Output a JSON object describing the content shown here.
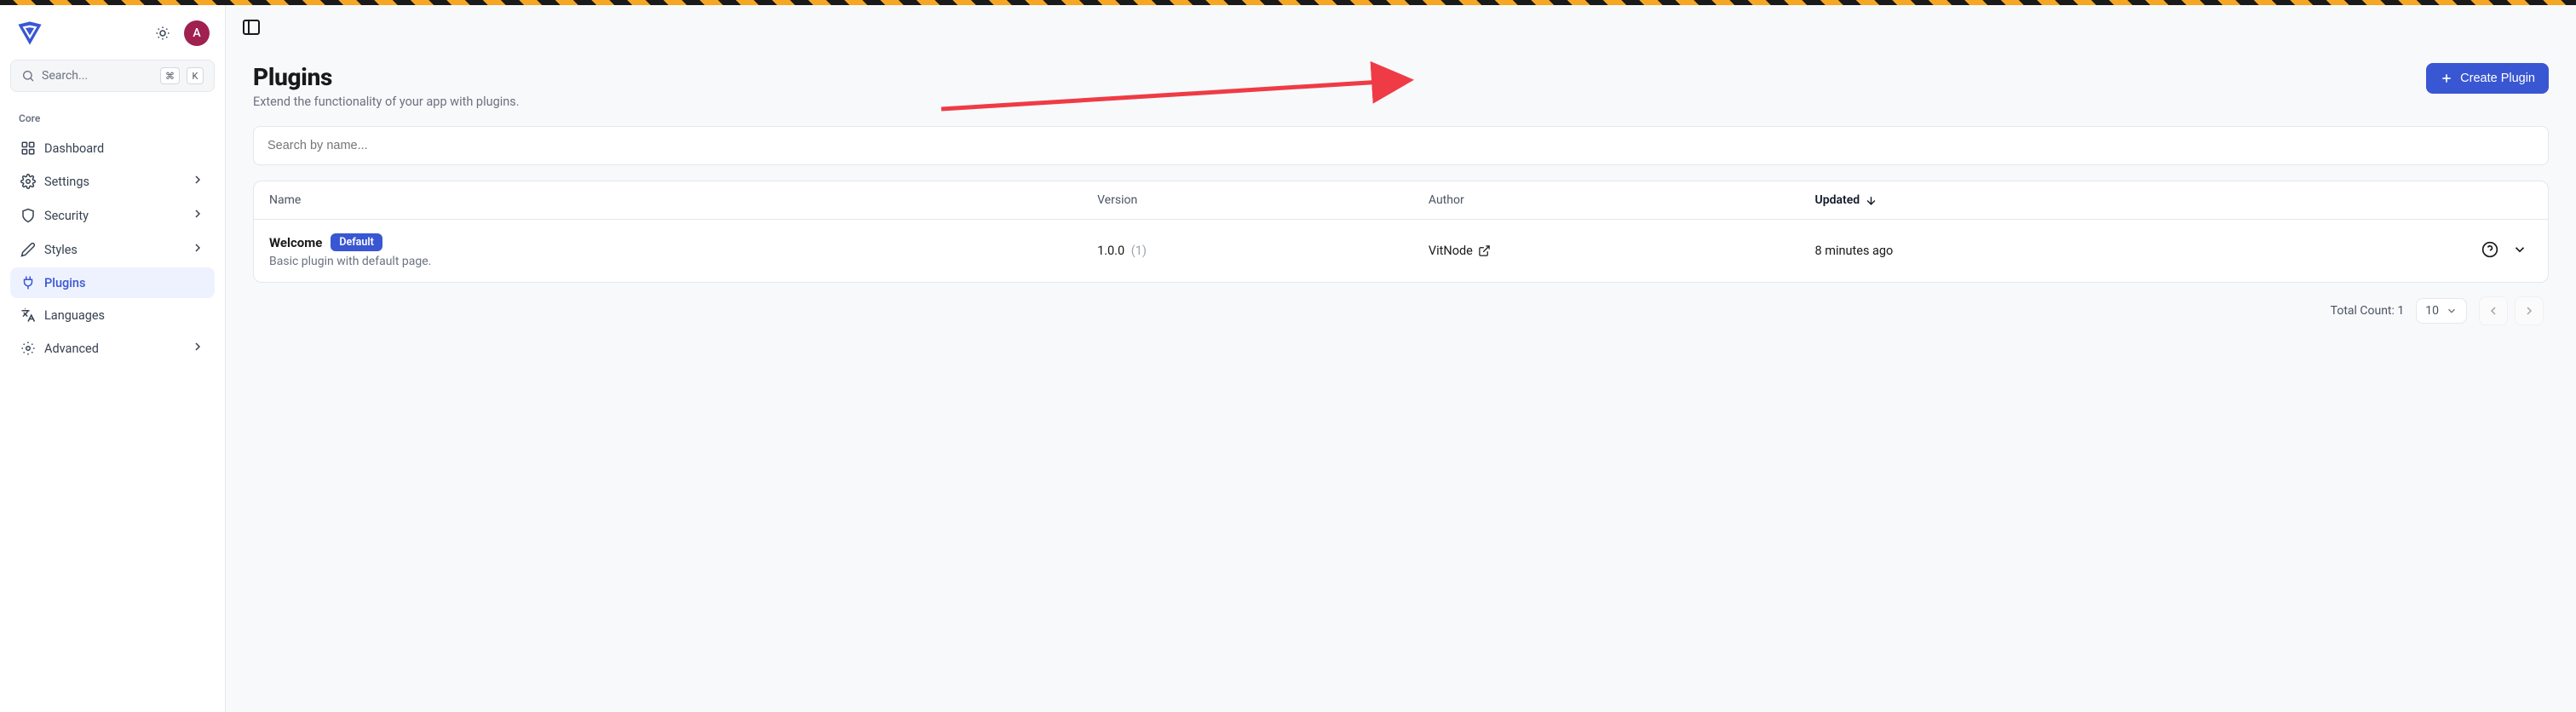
{
  "avatar_letter": "A",
  "search_launcher": {
    "placeholder": "Search...",
    "kbd1": "⌘",
    "kbd2": "K"
  },
  "sidebar": {
    "section_label": "Core",
    "items": [
      {
        "label": "Dashboard",
        "icon": "grid"
      },
      {
        "label": "Settings",
        "icon": "gear",
        "expandable": true
      },
      {
        "label": "Security",
        "icon": "shield",
        "expandable": true
      },
      {
        "label": "Styles",
        "icon": "pencil",
        "expandable": true
      },
      {
        "label": "Plugins",
        "icon": "plug",
        "active": true
      },
      {
        "label": "Languages",
        "icon": "lang"
      },
      {
        "label": "Advanced",
        "icon": "gear2",
        "expandable": true
      }
    ]
  },
  "page": {
    "title": "Plugins",
    "subtitle": "Extend the functionality of your app with plugins.",
    "create_label": "Create Plugin",
    "search_placeholder": "Search by name..."
  },
  "table": {
    "columns": {
      "name": "Name",
      "version": "Version",
      "author": "Author",
      "updated": "Updated"
    },
    "row": {
      "name": "Welcome",
      "badge": "Default",
      "desc": "Basic plugin with default page.",
      "version": "1.0.0",
      "version_sub": "(1)",
      "author": "VitNode",
      "updated": "8 minutes ago"
    }
  },
  "footer": {
    "total_label": "Total Count: 1",
    "page_size": "10"
  }
}
